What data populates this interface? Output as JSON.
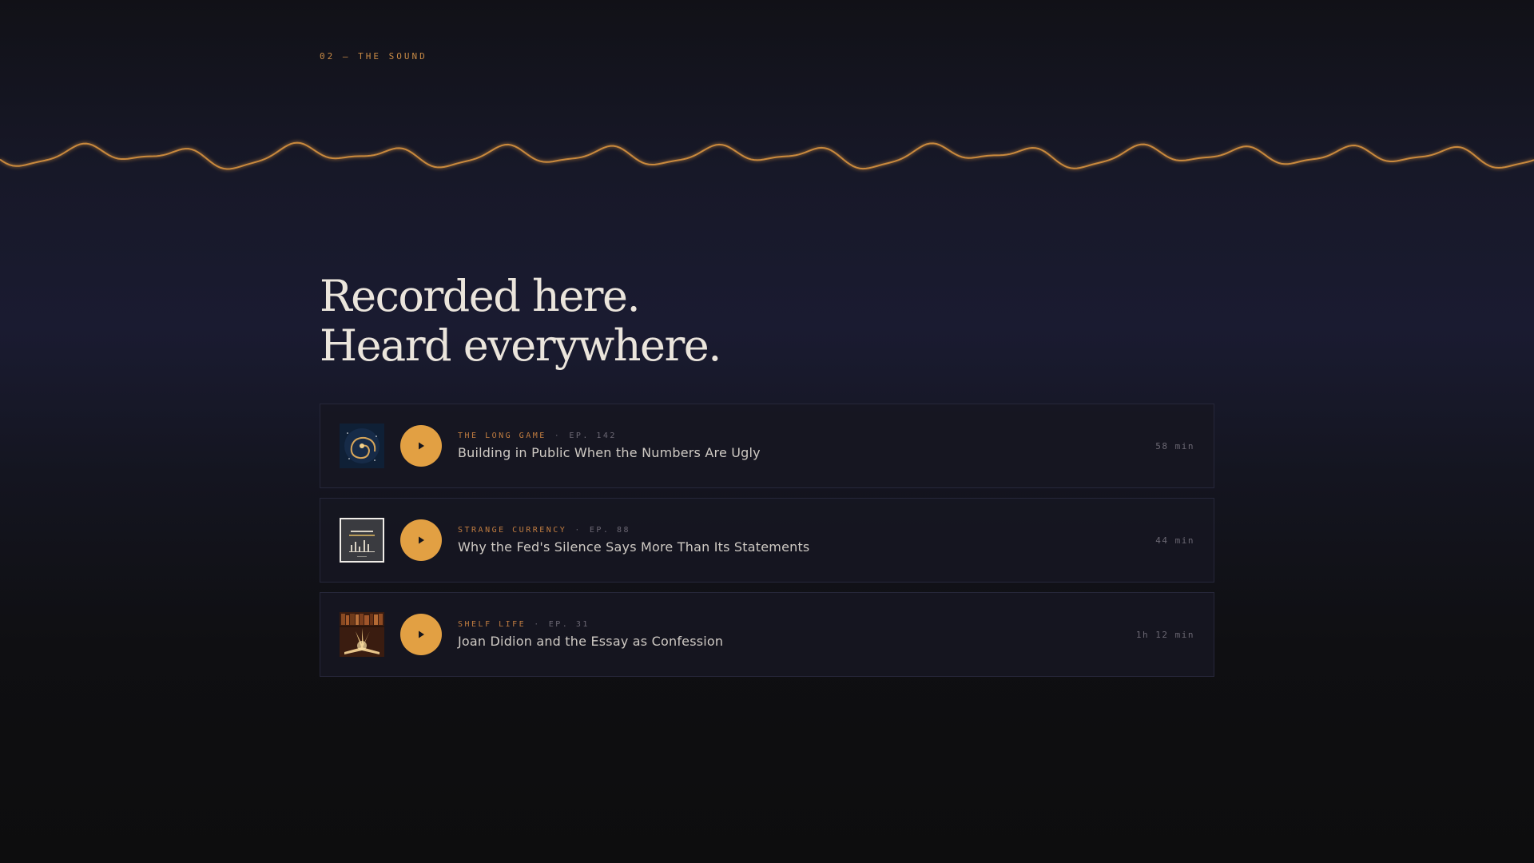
{
  "section": {
    "eyebrow": "02 — THE SOUND"
  },
  "headline": "Recorded here. Heard everywhere.",
  "colors": {
    "accent": "#e2a043",
    "waveform": "#c9893e",
    "kicker": "#c07c40"
  },
  "episodes": [
    {
      "show": "THE LONG GAME",
      "episode": "EP. 142",
      "title": "Building in Public When the Numbers Are Ugly",
      "duration": "58 min",
      "cover_icon": "galaxy-spiral-cover"
    },
    {
      "show": "STRANGE CURRENCY",
      "episode": "EP. 88",
      "title": "Why the Fed's Silence Says More Than Its Statements",
      "duration": "44 min",
      "cover_icon": "bar-chart-cover"
    },
    {
      "show": "SHELF LIFE",
      "episode": "EP. 31",
      "title": "Joan Didion and the Essay as Confession",
      "duration": "1h 12 min",
      "cover_icon": "glowing-book-cover"
    }
  ]
}
